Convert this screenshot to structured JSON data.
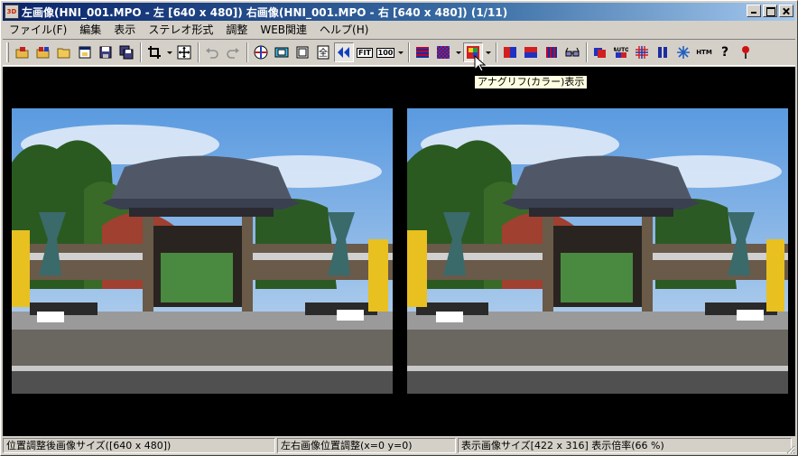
{
  "window": {
    "app_icon_text": "3D",
    "title": "左画像(HNI_001.MPO - 左 [640 x 480]) 右画像(HNI_001.MPO - 右 [640 x 480])  (1/11)"
  },
  "menu": [
    {
      "label": "ファイル(F)"
    },
    {
      "label": "編集"
    },
    {
      "label": "表示"
    },
    {
      "label": "ステレオ形式"
    },
    {
      "label": "調整"
    },
    {
      "label": "WEB関連"
    },
    {
      "label": "ヘルプ(H)"
    }
  ],
  "toolbar": {
    "fit_label": "FIT",
    "zoom100_label": "100",
    "html_label": "HTM",
    "help_label": "?"
  },
  "tooltip": "アナグリフ(カラー)表示",
  "status": {
    "cell1": "位置調整後画像サイズ([640 x 480])",
    "cell2": "左右画像位置調整(x=0 y=0)",
    "cell3": "表示画像サイズ[422 x 316]  表示倍率(66 %)"
  },
  "colors": {
    "title_start": "#0a246a",
    "title_end": "#a6caf0",
    "viewer_bg": "#000000",
    "tooltip_bg": "#ffffe1"
  }
}
